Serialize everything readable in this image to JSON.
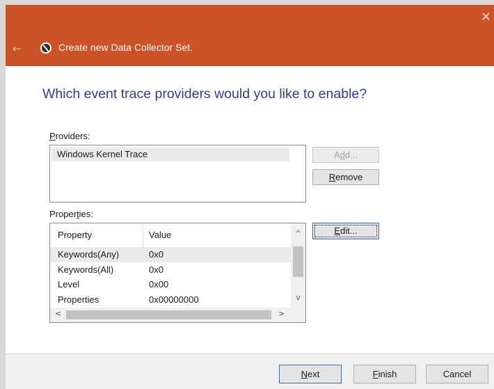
{
  "window": {
    "title": "Create new Data Collector Set.",
    "close_glyph": "✕",
    "back_glyph": "←",
    "accent_color": "#cc5228",
    "icon": "data-collector-icon"
  },
  "page": {
    "heading": "Which event trace providers would you like to enable?"
  },
  "providers": {
    "label_pre": "",
    "label_mnemonic": "P",
    "label_post": "roviders:",
    "items": [
      "Windows Kernel Trace"
    ],
    "add_pre": "A",
    "add_mnemonic": "d",
    "add_post": "d...",
    "remove_pre": "",
    "remove_mnemonic": "R",
    "remove_post": "emove"
  },
  "properties": {
    "label_pre": "Proper",
    "label_mnemonic": "t",
    "label_post": "ies:",
    "columns": [
      "Property",
      "Value"
    ],
    "rows": [
      {
        "property": "Keywords(Any)",
        "value": "0x0"
      },
      {
        "property": "Keywords(All)",
        "value": "0x0"
      },
      {
        "property": "Level",
        "value": "0x00"
      },
      {
        "property": "Properties",
        "value": "0x00000000"
      }
    ],
    "edit_pre": "",
    "edit_mnemonic": "E",
    "edit_post": "dit..."
  },
  "scroll_glyphs": {
    "up": "^",
    "down": "v",
    "left": "<",
    "right": ">"
  },
  "footer": {
    "next_pre": "",
    "next_mnemonic": "N",
    "next_post": "ext",
    "finish_pre": "",
    "finish_mnemonic": "F",
    "finish_post": "inish",
    "cancel": "Cancel"
  }
}
